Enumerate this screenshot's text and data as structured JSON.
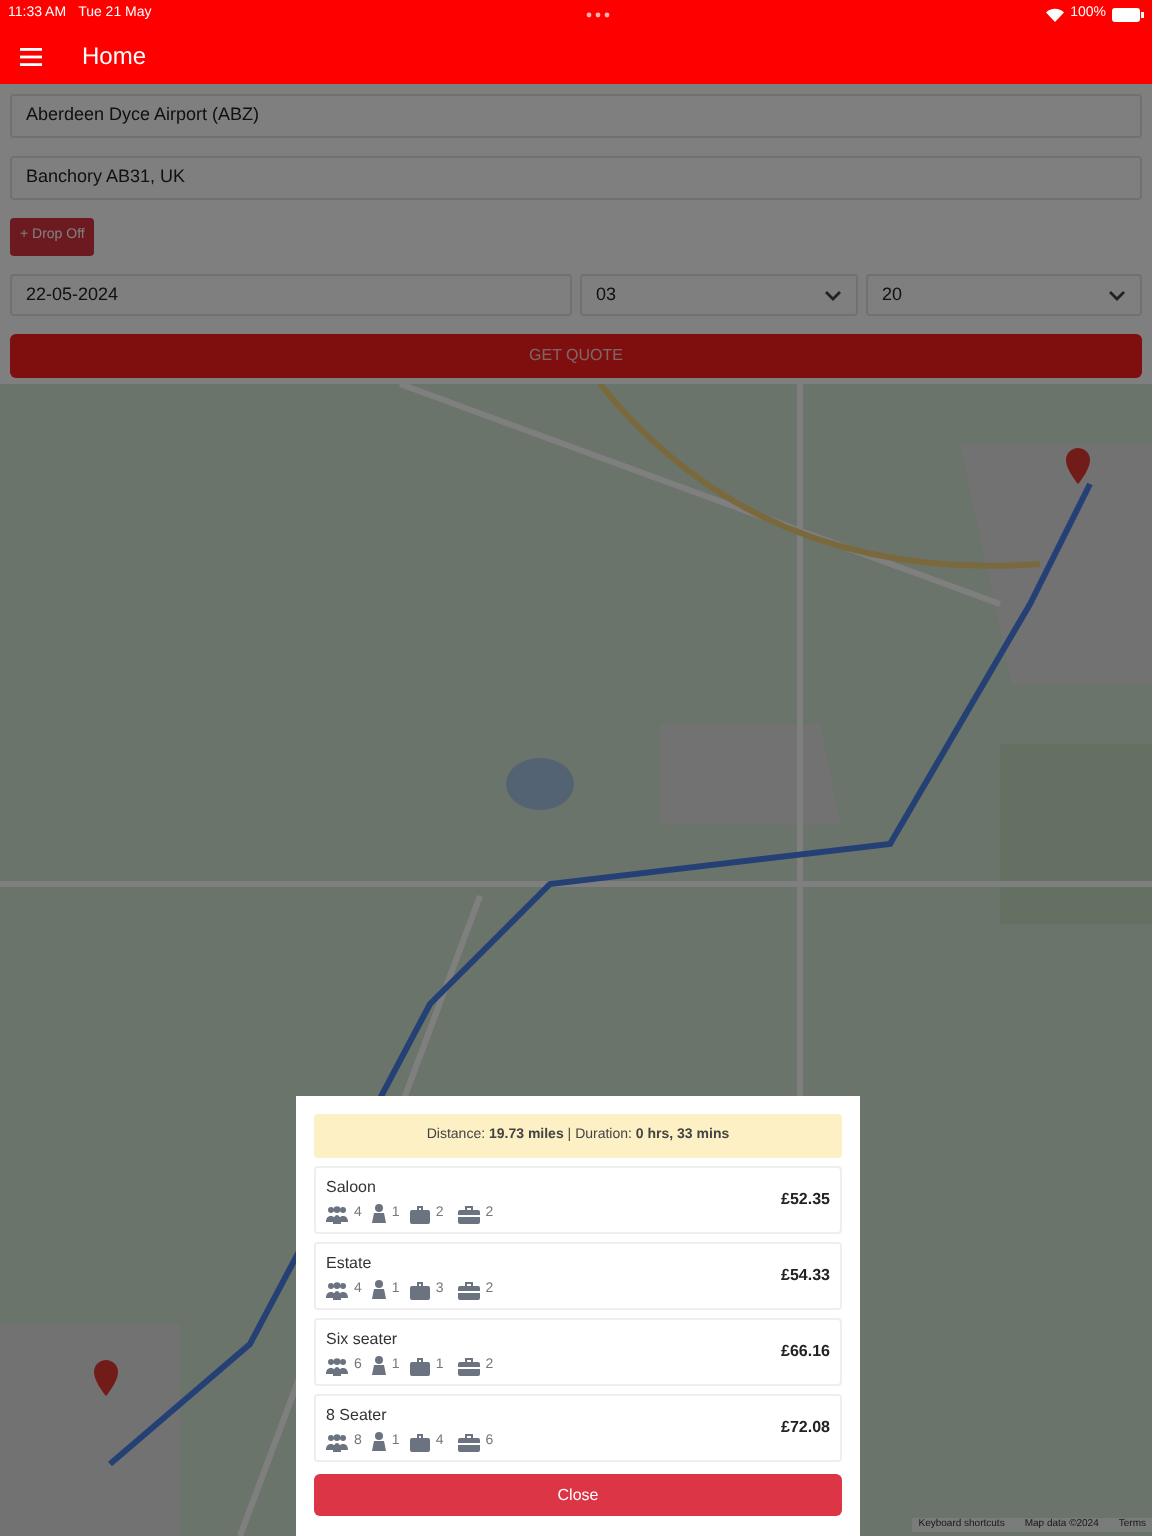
{
  "status_bar": {
    "time": "11:33 AM",
    "date": "Tue 21 May",
    "battery": "100%"
  },
  "header": {
    "title": "Home"
  },
  "form": {
    "pickup": {
      "value": "Aberdeen Dyce Airport (ABZ)"
    },
    "dropoff": {
      "value": "Banchory AB31, UK"
    },
    "add_button": "+ Drop Off",
    "date": {
      "value": "22-05-2024"
    },
    "hour": {
      "value": "03"
    },
    "minute": {
      "value": "20"
    },
    "quote_button": "GET QUOTE"
  },
  "map": {
    "footer": [
      "Keyboard shortcuts",
      "Map data ©2024",
      "Terms"
    ]
  },
  "dialog": {
    "summary": "Distance: **19.73 miles** | Duration: **0 hrs, 33 mins**",
    "vehicles": [
      {
        "name": "Saloon",
        "passengers": "4",
        "child_seats": "1",
        "luggage": "2",
        "hand_luggage": "2",
        "price": "£52.35"
      },
      {
        "name": "Estate",
        "passengers": "4",
        "child_seats": "1",
        "luggage": "3",
        "hand_luggage": "2",
        "price": "£54.33"
      },
      {
        "name": "Six seater",
        "passengers": "6",
        "child_seats": "1",
        "luggage": "1",
        "hand_luggage": "2",
        "price": "£66.16"
      },
      {
        "name": "8 Seater",
        "passengers": "8",
        "child_seats": "1",
        "luggage": "4",
        "hand_luggage": "6",
        "price": "£72.08"
      }
    ],
    "close_button": "Close"
  }
}
